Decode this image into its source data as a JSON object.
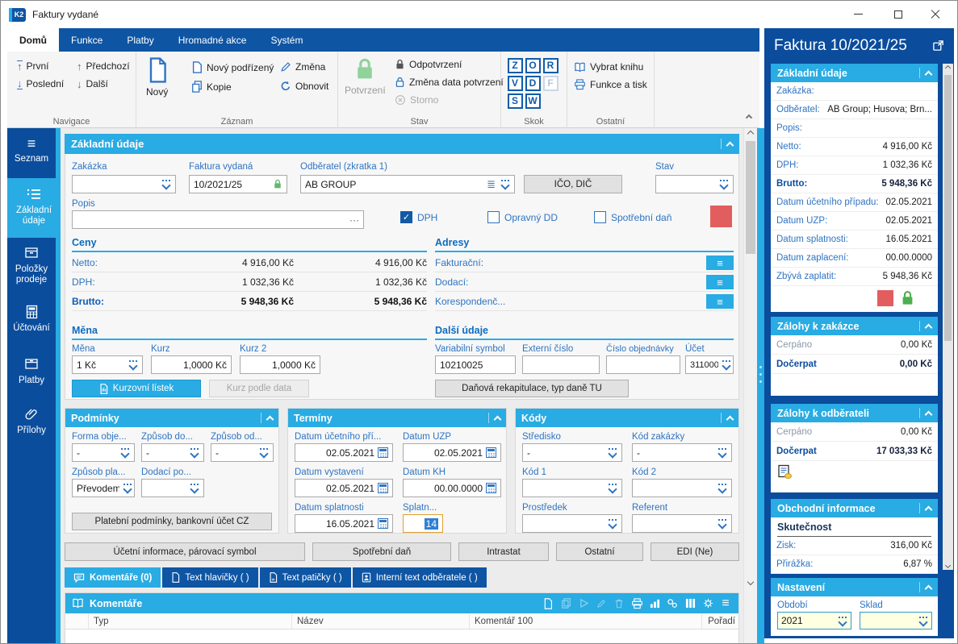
{
  "colors": {
    "accent": "#29abe3",
    "navy": "#0b4d9d",
    "ribbon_blue": "#0e55a4",
    "label_blue": "#2e74c2",
    "red_flag": "#e25d5d",
    "green_lock": "#7bc47f",
    "field_yellow": "#ffffe1",
    "selection": "#2f7fd6"
  },
  "icons": {
    "hamburger": "≡",
    "ellipsis": "···",
    "stack": "≣",
    "check": "✓",
    "up": "↑",
    "down": "↓"
  },
  "titlebar": {
    "logo": "K2",
    "title": "Faktury vydané"
  },
  "ribbon_tabs": {
    "t0": "Domů",
    "t1": "Funkce",
    "t2": "Platby",
    "t3": "Hromadné akce",
    "t4": "Systém"
  },
  "nav": {
    "first": "První",
    "last": "Poslední",
    "prev": "Předchozí",
    "next": "Další",
    "group": "Navigace"
  },
  "record": {
    "new": "Nový",
    "new_child": "Nový podřízený",
    "copy": "Kopie",
    "change": "Změna",
    "refresh": "Obnovit",
    "group": "Záznam"
  },
  "state": {
    "confirm": "Potvrzení",
    "unconfirm": "Odpotvrzení",
    "change_date": "Změna data potvrzení",
    "storno": "Storno",
    "group": "Stav"
  },
  "jump": {
    "l0": "Z",
    "l1": "O",
    "l2": "R",
    "l3": "V",
    "l4": "D",
    "l5": "F",
    "l6": "S",
    "l7": "W",
    "group": "Skok"
  },
  "other": {
    "book": "Vybrat knihu",
    "print": "Funkce a tisk",
    "group": "Ostatní"
  },
  "sidebar": {
    "i0": "Seznam",
    "i1": "Základní údaje",
    "i2": "Položky prodeje",
    "i3": "Účtování",
    "i4": "Platby",
    "i5": "Přílohy"
  },
  "form": {
    "section": "Základní údaje",
    "zakazka_label": "Zakázka",
    "zakazka": "",
    "faktura_label": "Faktura vydaná",
    "faktura": "10/2021/25",
    "odberatel_label": "Odběratel (zkratka 1)",
    "odberatel": "AB GROUP",
    "ico_btn": "IČO, DIČ",
    "stav_label": "Stav",
    "stav": "",
    "popis_label": "Popis",
    "popis": "",
    "cb_dph": "DPH",
    "cb_oprav": "Opravný DD",
    "cb_spotr": "Spotřební daň"
  },
  "ceny": {
    "header": "Ceny",
    "netto_l": "Netto:",
    "netto1": "4 916,00 Kč",
    "netto2": "4 916,00 Kč",
    "dph_l": "DPH:",
    "dph1": "1 032,36 Kč",
    "dph2": "1 032,36 Kč",
    "brutto_l": "Brutto:",
    "brutto1": "5 948,36 Kč",
    "brutto2": "5 948,36 Kč"
  },
  "adresy": {
    "header": "Adresy",
    "r0": "Fakturační:",
    "r1": "Dodací:",
    "r2": "Korespondenč..."
  },
  "mena": {
    "header": "Měna",
    "mena_l": "Měna",
    "mena": "1 Kč",
    "kurz_l": "Kurz",
    "kurz": "1,0000 Kč",
    "kurz2_l": "Kurz 2",
    "kurz2": "1,0000 Kč",
    "btn_listek": "Kurzovní lístek",
    "btn_data": "Kurz podle data"
  },
  "dalsi": {
    "header": "Další údaje",
    "vs_l": "Variabilní symbol",
    "vs": "10210025",
    "ext_l": "Externí číslo",
    "ext": "",
    "obj_l": "Číslo objednávky",
    "obj": "",
    "ucet_l": "Účet",
    "ucet": "311000",
    "btn_rekap": "Daňová rekapitulace, typ daně TU"
  },
  "podminky": {
    "header": "Podmínky",
    "f0l": "Forma obje...",
    "f0": "-",
    "f1l": "Způsob do...",
    "f1": "-",
    "f2l": "Způsob od...",
    "f2": "-",
    "f3l": "Způsob pla...",
    "f3": "Převodem",
    "f4l": "Dodací po...",
    "f4": "",
    "btn": "Platební podmínky, bankovní účet CZ"
  },
  "terminy": {
    "header": "Termíny",
    "d0l": "Datum účetního pří...",
    "d0": "02.05.2021",
    "d1l": "Datum UZP",
    "d1": "02.05.2021",
    "d2l": "Datum vystavení",
    "d2": "02.05.2021",
    "d3l": "Datum KH",
    "d3": "00.00.0000",
    "d4l": "Datum splatnosti",
    "d4": "16.05.2021",
    "d5l": "Splatn...",
    "d5": "14"
  },
  "kody": {
    "header": "Kódy",
    "k0l": "Středisko",
    "k0": "-",
    "k1l": "Kód zakázky",
    "k1": "-",
    "k2l": "Kód 1",
    "k2": "",
    "k3l": "Kód 2",
    "k3": "",
    "k4l": "Prostředek",
    "k4": "",
    "k5l": "Referent",
    "k5": ""
  },
  "btn_row": {
    "b0": "Účetní informace, párovací symbol",
    "b1": "Spotřební daň",
    "b2": "Intrastat",
    "b3": "Ostatní",
    "b4": "EDI (Ne)"
  },
  "tabs2": {
    "t0": "Komentáře (0)",
    "t1": "Text hlavičky ( )",
    "t2": "Text patičky ( )",
    "t3": "Interní text odběratele ( )"
  },
  "comments": {
    "header": "Komentáře",
    "c0": "Typ",
    "c1": "Název",
    "c2": "Komentář 100",
    "c3": "Pořadí"
  },
  "side": {
    "title": "Faktura 10/2021/25",
    "basic_header": "Základní údaje",
    "r0l": "Zakázka:",
    "r0": "",
    "r1l": "Odběratel:",
    "r1": "AB Group; Husova; Brn...",
    "r2l": "Popis:",
    "r2": "",
    "r3l": "Netto:",
    "r3": "4 916,00 Kč",
    "r4l": "DPH:",
    "r4": "1 032,36 Kč",
    "r5l": "Brutto:",
    "r5": "5 948,36 Kč",
    "r6l": "Datum účetního případu:",
    "r6": "02.05.2021",
    "r7l": "Datum UZP:",
    "r7": "02.05.2021",
    "r8l": "Datum splatnosti:",
    "r8": "16.05.2021",
    "r9l": "Datum zaplacení:",
    "r9": "00.00.0000",
    "r10l": "Zbývá zaplatit:",
    "r10": "5 948,36 Kč",
    "z1_header": "Zálohy k zakázce",
    "z1_cl": "Čerpáno",
    "z1_c": "0,00 Kč",
    "z1_dl": "Dočerpat",
    "z1_d": "0,00 Kč",
    "z2_header": "Zálohy k odběrateli",
    "z2_cl": "Čerpáno",
    "z2_c": "0,00 Kč",
    "z2_dl": "Dočerpat",
    "z2_d": "17 033,33 Kč",
    "ob_header": "Obchodní informace",
    "ob_sub": "Skutečnost",
    "ob_zisk_l": "Zisk:",
    "ob_zisk": "316,00 Kč",
    "ob_pr_l": "Přirážka:",
    "ob_pr": "6,87 %",
    "na_header": "Nastavení",
    "na_obdobi_l": "Období",
    "na_obdobi": "2021",
    "na_sklad_l": "Sklad",
    "na_sklad": ""
  }
}
